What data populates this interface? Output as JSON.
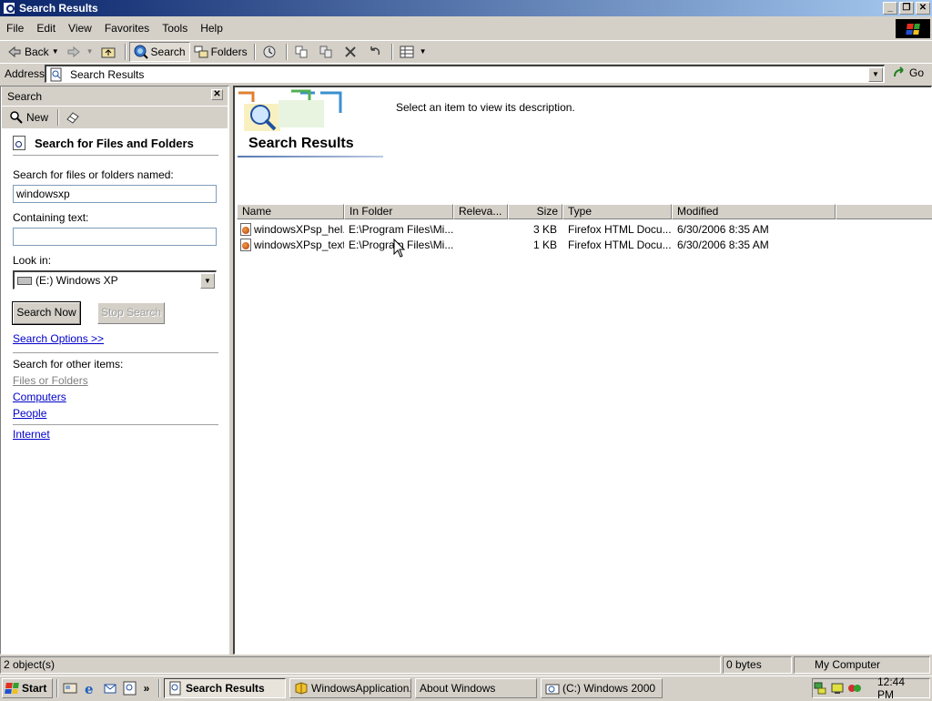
{
  "window": {
    "title": "Search Results",
    "buttons": [
      "minimize",
      "restore",
      "close"
    ]
  },
  "menu": [
    "File",
    "Edit",
    "View",
    "Favorites",
    "Tools",
    "Help"
  ],
  "toolbar": {
    "back": "Back",
    "search": "Search",
    "folders": "Folders"
  },
  "address": {
    "label": "Address",
    "value": "Search Results",
    "go": "Go"
  },
  "search_pane": {
    "header": "Search",
    "new_label": "New",
    "title": "Search for Files and Folders",
    "named_label": "Search for files or folders named:",
    "named_value": "windowsxp",
    "containing_label": "Containing text:",
    "containing_value": "",
    "lookin_label": "Look in:",
    "lookin_value": "(E:) Windows XP",
    "search_now": "Search Now",
    "stop_search": "Stop Search",
    "options_link": "Search Options >>",
    "other_label": "Search for other items:",
    "other_links": [
      "Files or Folders",
      "Computers",
      "People"
    ],
    "internet_link": "Internet"
  },
  "results": {
    "description": "Select an item to view its description.",
    "title": "Search Results",
    "columns": [
      "Name",
      "In Folder",
      "Releva...",
      "Size",
      "Type",
      "Modified"
    ],
    "rows": [
      {
        "name": "windowsXPsp_hel...",
        "folder": "E:\\Program Files\\Mi...",
        "relevance": "",
        "size": "3 KB",
        "type": "Firefox HTML Docu...",
        "modified": "6/30/2006 8:35 AM"
      },
      {
        "name": "windowsXPsp_text...",
        "folder": "E:\\Program Files\\Mi...",
        "relevance": "",
        "size": "1 KB",
        "type": "Firefox HTML Docu...",
        "modified": "6/30/2006 8:35 AM"
      }
    ]
  },
  "status": {
    "objects": "2 object(s)",
    "bytes": "0 bytes",
    "zone": "My Computer"
  },
  "taskbar": {
    "start": "Start",
    "tasks": [
      "Search Results",
      "WindowsApplication...",
      "About Windows",
      "(C:) Windows 2000"
    ],
    "clock": "12:44 PM"
  },
  "colors": {
    "title_gradient_start": "#0a246a",
    "title_gradient_end": "#a6caf0",
    "face": "#d4d0c8",
    "link": "#0000cc"
  }
}
